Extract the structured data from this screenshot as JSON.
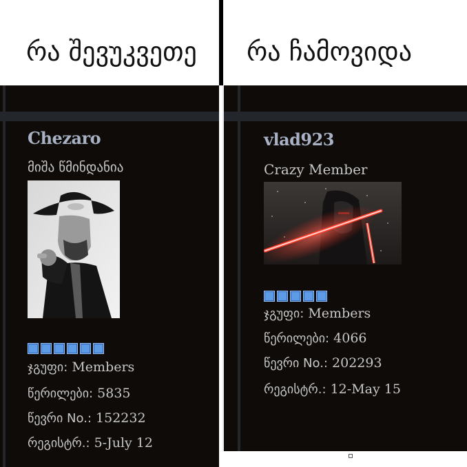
{
  "header": {
    "left_caption": "რა შევუკვეთე",
    "right_caption": "რა ჩამოვიდა"
  },
  "left_profile": {
    "username": "Chezaro",
    "user_title": "მიშა წმინდანია",
    "rank_pips": 6,
    "group_label": "ჯგუფი:",
    "group_value": "Members",
    "posts_label": "წერილები:",
    "posts_value": "5835",
    "member_no_label": "წევრი No.:",
    "member_no_value": "152232",
    "registered_label": "რეგისტრ.:",
    "registered_value": "5-July 12",
    "avatar_icon": "biker-portrait-avatar"
  },
  "right_profile": {
    "username": "vlad923",
    "user_title": "Crazy Member",
    "rank_pips": 5,
    "group_label": "ჯგუფი:",
    "group_value": "Members",
    "posts_label": "წერილები:",
    "posts_value": "4066",
    "member_no_label": "წევრი No.:",
    "member_no_value": "202293",
    "registered_label": "რეგისტრ.:",
    "registered_value": "12-May 15",
    "avatar_icon": "kylo-ren-lightsaber-avatar"
  },
  "colors": {
    "panel_bg": "#0e0b09",
    "username": "#a8b2c4",
    "pip_blue": "#5d9be6"
  }
}
